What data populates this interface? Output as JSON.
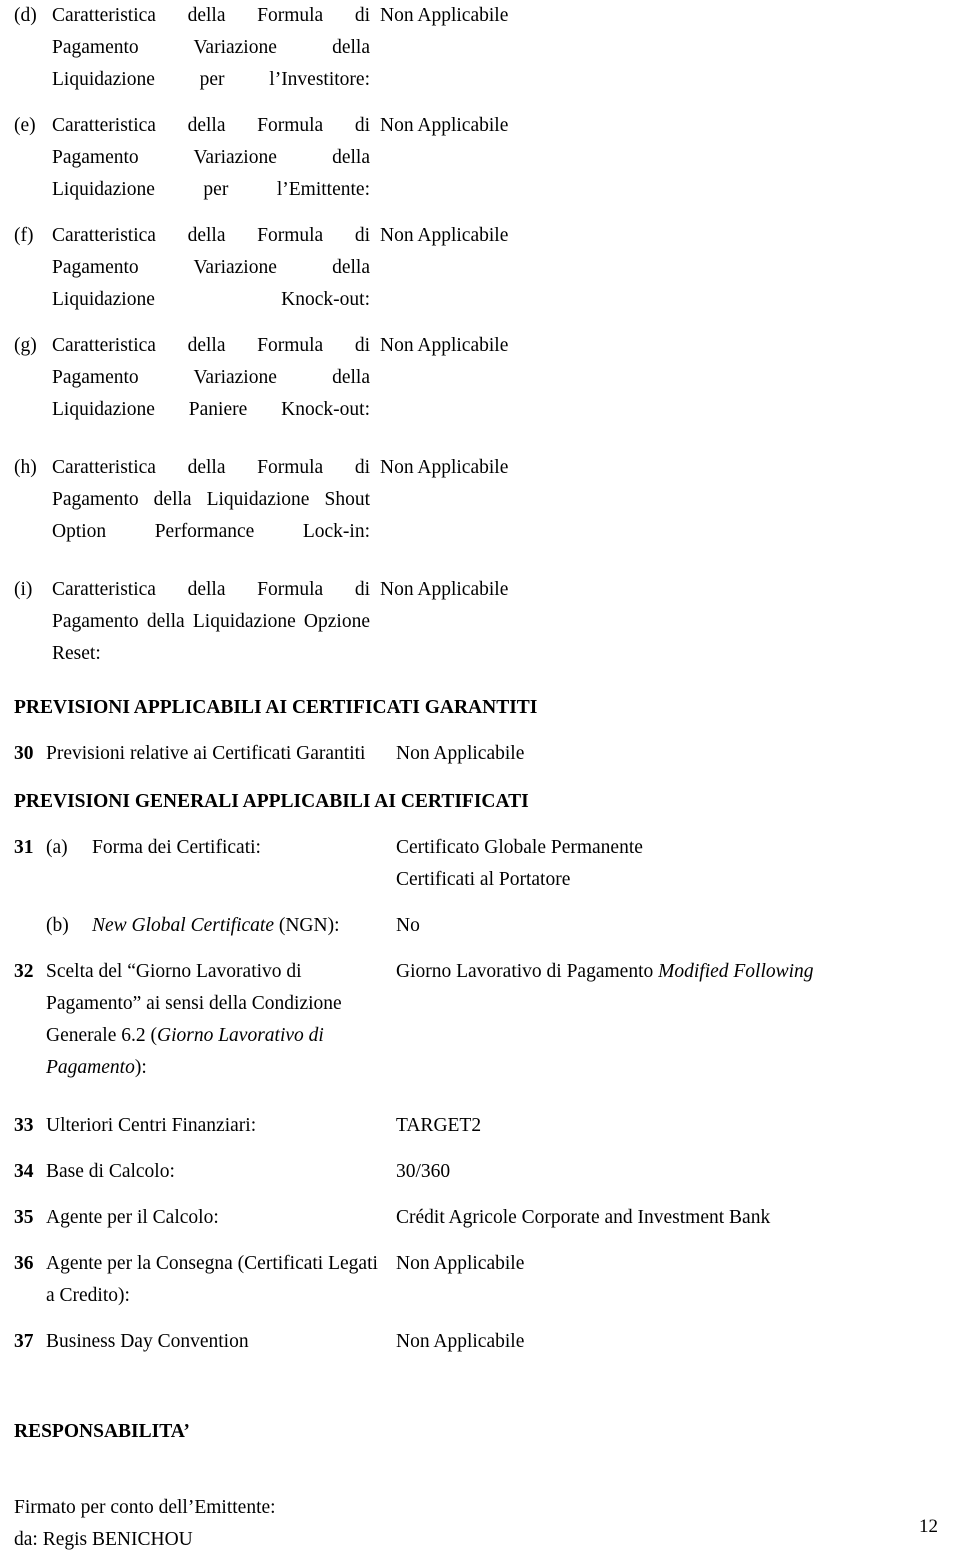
{
  "document": {
    "page_number": "12",
    "lettered_items": [
      {
        "marker": "(d)",
        "label": "Caratteristica della Formula di Pagamento Variazione della Liquidazione per l’Investitore:",
        "value": "Non Applicabile"
      },
      {
        "marker": "(e)",
        "label": "Caratteristica della Formula di Pagamento Variazione della Liquidazione per l’Emittente:",
        "value": "Non Applicabile"
      },
      {
        "marker": "(f)",
        "label": "Caratteristica della Formula di Pagamento Variazione della Liquidazione Knock-out:",
        "value": "Non Applicabile"
      },
      {
        "marker": "(g)",
        "label": "Caratteristica della Formula di Pagamento Variazione della Liquidazione Paniere Knock-out:",
        "value": "Non Applicabile"
      },
      {
        "marker": "(h)",
        "label": "Caratteristica della Formula di Pagamento della Liquidazione Shout Option Performance Lock-in:",
        "value": "Non Applicabile"
      },
      {
        "marker": "(i)",
        "label": "Caratteristica della Formula di Pagamento della Liquidazione Opzione Reset:",
        "value": "Non Applicabile"
      }
    ],
    "section_garantiti": {
      "title": "PREVISIONI APPLICABILI AI CERTIFICATI GARANTITI",
      "row": {
        "number": "30",
        "label": "Previsioni relative ai Certificati Garantiti",
        "value": "Non Applicabile"
      }
    },
    "section_generali": {
      "title": "PREVISIONI GENERALI APPLICABILI AI CERTIFICATI",
      "rows": [
        {
          "number": "31",
          "marker": "(a)",
          "label": "Forma dei Certificati:",
          "value_line1": "Certificato Globale Permanente",
          "value_line2": "Certificati al Portatore"
        },
        {
          "number": "",
          "marker": "(b)",
          "label_italic": "New Global Certificate",
          "label_rest": " (NGN):",
          "value": "No"
        },
        {
          "number": "32",
          "label_part1": "Scelta del “Giorno Lavorativo di Pagamento” ai sensi della Condizione Generale 6.2 (",
          "label_italic": "Giorno Lavorativo di Pagamento",
          "label_part2": "):",
          "value_part1": "Giorno Lavorativo di Pagamento ",
          "value_italic": "Modified Following"
        },
        {
          "number": "33",
          "label": "Ulteriori Centri Finanziari:",
          "value": "TARGET2"
        },
        {
          "number": "34",
          "label": "Base di Calcolo:",
          "value": "30/360"
        },
        {
          "number": "35",
          "label": "Agente per il Calcolo:",
          "value": "Crédit Agricole Corporate and Investment Bank"
        },
        {
          "number": "36",
          "label": "Agente per la Consegna (Certificati Legati a Credito):",
          "value": "Non Applicabile"
        },
        {
          "number": "37",
          "label": "Business Day Convention",
          "value": "Non Applicabile"
        }
      ]
    },
    "responsabilita": {
      "title": "RESPONSABILITA’",
      "line1": "Firmato per conto dell’Emittente:",
      "line2": "da: Regis BENICHOU"
    }
  }
}
